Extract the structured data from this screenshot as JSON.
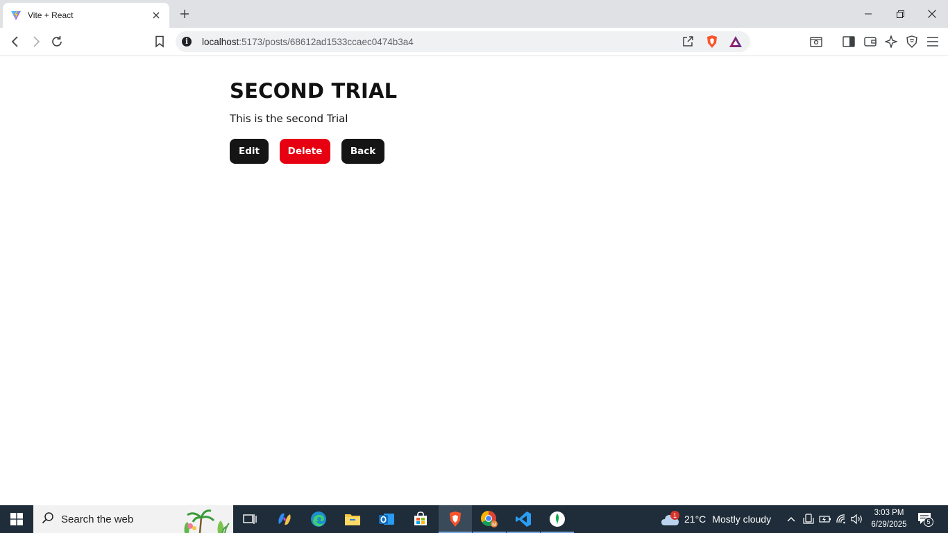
{
  "browser": {
    "tab": {
      "title": "Vite + React",
      "favicon": "vite-logo-icon"
    },
    "url": {
      "host": "localhost",
      "path": ":5173/posts/68612ad1533ccaec0474b3a4"
    }
  },
  "post": {
    "title": "SECOND TRIAL",
    "body": "This is the second Trial"
  },
  "actions": {
    "edit_label": "Edit",
    "delete_label": "Delete",
    "back_label": "Back"
  },
  "taskbar": {
    "search_placeholder": "Search the web",
    "weather": {
      "temp": "21°C",
      "condition": "Mostly cloudy",
      "alert_count": "1"
    },
    "clock": {
      "time": "3:03 PM",
      "date": "6/29/2025"
    },
    "notification_count": "5"
  },
  "colors": {
    "button_dark": "#151515",
    "button_delete": "#e60012",
    "taskbar_bg": "#1f2d3a",
    "tabstrip_bg": "#dfe1e5"
  }
}
